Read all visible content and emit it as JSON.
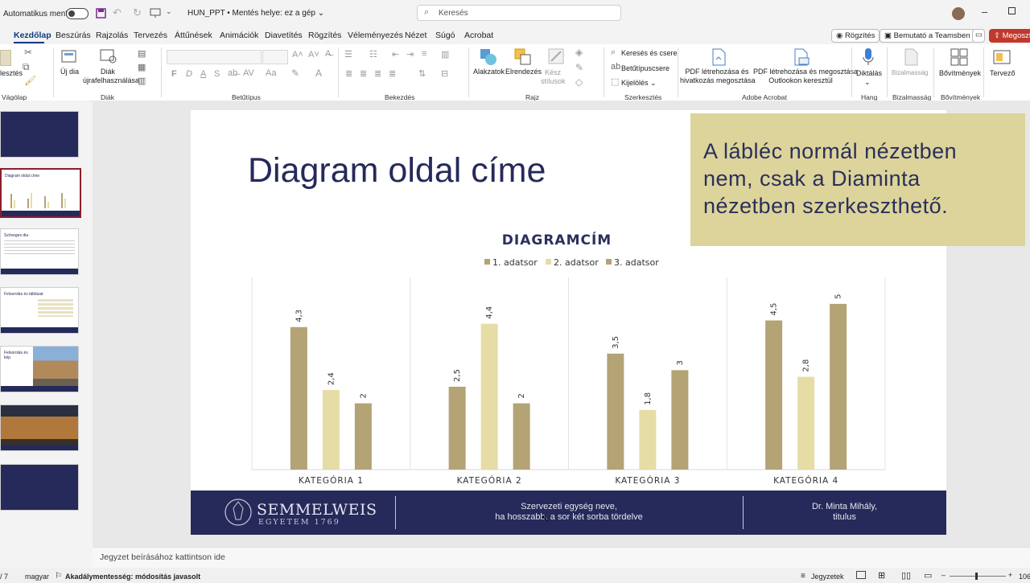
{
  "titlebar": {
    "autosave_label": "Automatikus mentés",
    "doc_title": "HUN_PPT • Mentés helye: ez a gép",
    "search_placeholder": "Keresés"
  },
  "menu": {
    "tabs": [
      "Kezdőlap",
      "Beszúrás",
      "Rajzolás",
      "Tervezés",
      "Áttűnések",
      "Animációk",
      "Diavetítés",
      "Rögzítés",
      "Véleményezés",
      "Nézet",
      "Súgó",
      "Acrobat"
    ],
    "record_button": "Rögzítés",
    "teams_button": "Bemutató a Teamsben",
    "share_button": "Megoszt"
  },
  "ribbon": {
    "paste": "lesztés",
    "new_slide": "Új dia",
    "reuse_slides": [
      "Diák",
      "újrafelhasználása"
    ],
    "shapes": "Alakzatok",
    "arrange": "Elrendezés",
    "quick_styles": [
      "Kész",
      "stílusok"
    ],
    "find_replace": "Keresés és csere",
    "replace_font": "Betűtípuscsere",
    "select": "Kijelölés",
    "pdf_share": [
      "PDF létrehozása és",
      "hivatkozás megosztása"
    ],
    "pdf_outlook": [
      "PDF létrehozása és megosztása",
      "Outlookon keresztül"
    ],
    "dictate": "Diktálás",
    "sensitivity": "Bizalmasság",
    "addins": "Bővítmények",
    "designer": "Tervező",
    "format_bold": "F",
    "format_italic": "D",
    "format_underline": "A",
    "format_strike": "S",
    "groups": [
      "Vágólap",
      "Diák",
      "Betűtípus",
      "Bekezdés",
      "Rajz",
      "Szerkesztés",
      "Adobe Acrobat",
      "Hang",
      "Bizalmasság",
      "Bővítmények"
    ]
  },
  "thumbs": {
    "t2": "Diagram oldal címe",
    "t3": "Szöveges dia",
    "t4": "Felsorolás és táblázat",
    "t5": "Felsorolás és kép"
  },
  "slide": {
    "title": "Diagram oldal címe",
    "note": "A lábléc normál nézetben nem, csak a Diaminta nézetben szerkeszthető.",
    "footer_logo_main": "SEMMELWEIS",
    "footer_logo_sub": "EGYETEM 1769",
    "footer_center": [
      "Szervezeti egység neve,",
      "ha hosszabb, a sor két sorba tördelve"
    ],
    "footer_right": [
      "Dr. Minta Mihály,",
      "titulus"
    ]
  },
  "chart_data": {
    "type": "bar",
    "title": "DIAGRAMCÍM",
    "categories": [
      "KATEGÓRIA 1",
      "KATEGÓRIA 2",
      "KATEGÓRIA 3",
      "KATEGÓRIA 4"
    ],
    "series": [
      {
        "name": "1. adatsor",
        "values": [
          4.3,
          2.5,
          3.5,
          4.5
        ],
        "labels": [
          "4,3",
          "2,5",
          "3,5",
          "4,5"
        ],
        "color": "#b3a375"
      },
      {
        "name": "2. adatsor",
        "values": [
          2.4,
          4.4,
          1.8,
          2.8
        ],
        "labels": [
          "2,4",
          "4,4",
          "1,8",
          "2,8"
        ],
        "color": "#e6dca6"
      },
      {
        "name": "3. adatsor",
        "values": [
          2,
          2,
          3,
          5
        ],
        "labels": [
          "2",
          "2",
          "3",
          "5"
        ],
        "color": "#b3a375"
      }
    ],
    "ylim": [
      0,
      6
    ],
    "legend": "top",
    "grid": false
  },
  "notes": {
    "placeholder": "Jegyzet beírásához kattintson ide"
  },
  "status": {
    "slide_counter": "/ 7",
    "language": "magyar",
    "accessibility": "Akadálymentesség: módosítás javasolt",
    "notes_button": "Jegyzetek",
    "zoom": "106"
  }
}
